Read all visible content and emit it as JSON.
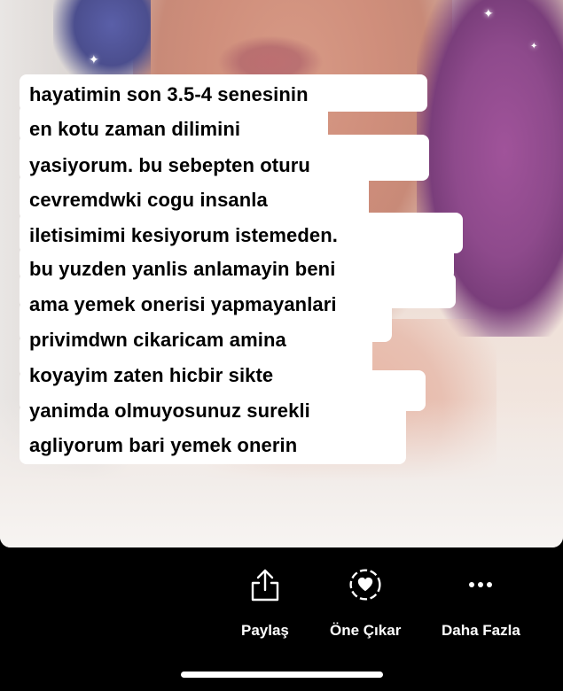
{
  "caption": {
    "lines": [
      "hayatimin son 3.5-4 senesinin",
      "en kotu zaman dilimini",
      "yasiyorum. bu sebepten oturu",
      "cevremdwki cogu insanla",
      "iletisimimi kesiyorum istemeden.",
      "bu yuzden yanlis anlamayin beni",
      "ama yemek onerisi yapmayanlari",
      "privimdwn cikaricam amina",
      "koyayim zaten hicbir sikte",
      "yanimda olmuyosunuz surekli",
      "agliyorum bari yemek onerin"
    ]
  },
  "actions": {
    "share": {
      "label": "Paylaş",
      "icon": "share-icon"
    },
    "highlight": {
      "label": "Öne Çıkar",
      "icon": "highlight-heart-icon"
    },
    "more": {
      "label": "Daha Fazla",
      "icon": "more-dots-icon"
    }
  },
  "colors": {
    "background": "#000000",
    "caption_bg": "#ffffff",
    "caption_text": "#000000",
    "action_text": "#ffffff"
  }
}
